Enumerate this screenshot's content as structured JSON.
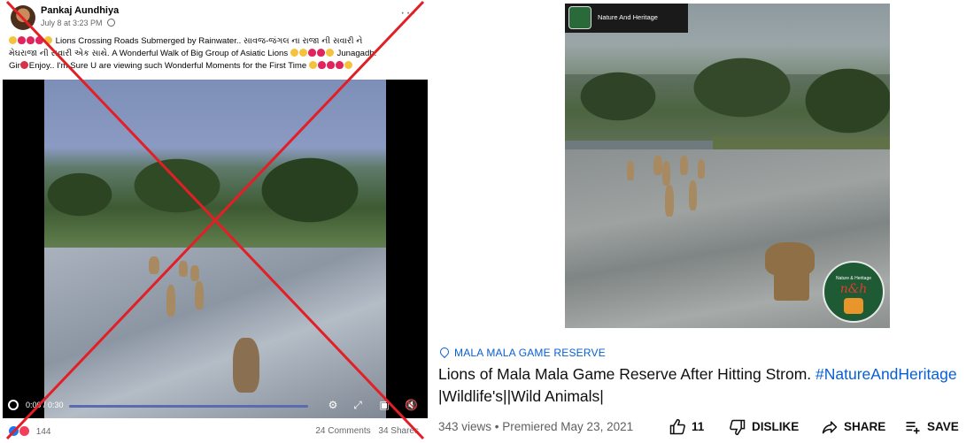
{
  "facebook": {
    "author": "Pankaj Aundhiya",
    "timestamp": "July 8 at 3:23 PM",
    "caption_line1": "Lions Crossing Roads Submerged by Rainwater.. સાવજ-જંગલ ના રાજા ની સવારી ને",
    "caption_line2": "મેઘરાજા ની સવારી એક સાથે. A Wonderful Walk of Big Group of Asiatic Lions",
    "caption_line2b": "Junagadh.",
    "caption_line3": "Gir",
    "caption_line3b": "Enjoy.. I'm Sure U are viewing such Wonderful Moments for the First Time",
    "video_time": "0:00 / 0:30",
    "reaction_count": "144",
    "comments": "24 Comments",
    "shares": "34 Shares",
    "overlay_color": "#e21f26"
  },
  "youtube": {
    "channel_badge": "Nature And Heritage",
    "watermark_top": "Nature & Heritage",
    "watermark_logo": "n&h",
    "location": "MALA MALA GAME RESERVE",
    "title_text": "Lions of Mala Mala Game Reserve After Hitting Strom.",
    "title_hashtag": "#NatureAndHeritage",
    "title_line2": "|Wildlife's||Wild Animals|",
    "views": "343 views",
    "premiered": "Premiered May 23, 2021",
    "like_count": "11",
    "dislike_label": "DISLIKE",
    "share_label": "SHARE",
    "save_label": "SAVE",
    "link_color": "#065fd4"
  }
}
